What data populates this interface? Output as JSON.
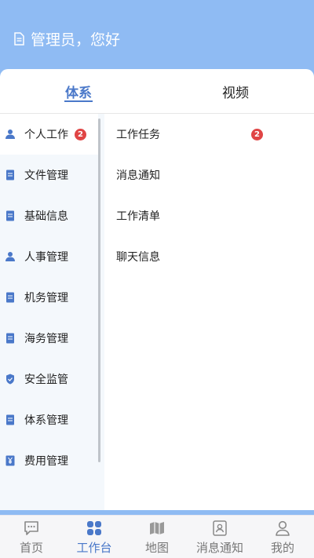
{
  "header": {
    "greeting": "管理员，您好"
  },
  "tabs": [
    {
      "label": "体系",
      "active": true
    },
    {
      "label": "视频",
      "active": false
    }
  ],
  "sidebar": {
    "items": [
      {
        "label": "个人工作",
        "icon": "person-icon",
        "badge": "2",
        "active": true
      },
      {
        "label": "文件管理",
        "icon": "document-icon"
      },
      {
        "label": "基础信息",
        "icon": "document-icon"
      },
      {
        "label": "人事管理",
        "icon": "person-icon"
      },
      {
        "label": "机务管理",
        "icon": "document-icon"
      },
      {
        "label": "海务管理",
        "icon": "document-icon"
      },
      {
        "label": "安全监管",
        "icon": "shield-icon"
      },
      {
        "label": "体系管理",
        "icon": "document-icon"
      },
      {
        "label": "费用管理",
        "icon": "yen-icon"
      }
    ]
  },
  "main": {
    "items": [
      {
        "label": "工作任务",
        "badge": "2"
      },
      {
        "label": "消息通知"
      },
      {
        "label": "工作清单"
      },
      {
        "label": "聊天信息"
      }
    ]
  },
  "bottom_nav": [
    {
      "label": "首页",
      "icon": "chat-bubble-icon"
    },
    {
      "label": "工作台",
      "icon": "grid-icon",
      "active": true
    },
    {
      "label": "地图",
      "icon": "map-icon"
    },
    {
      "label": "消息通知",
      "icon": "contact-card-icon"
    },
    {
      "label": "我的",
      "icon": "user-icon"
    }
  ],
  "colors": {
    "accent": "#4a78c9",
    "header_bg": "#8fbbf3",
    "badge": "#e04545",
    "sidebar_bg": "#f4f8fc"
  }
}
